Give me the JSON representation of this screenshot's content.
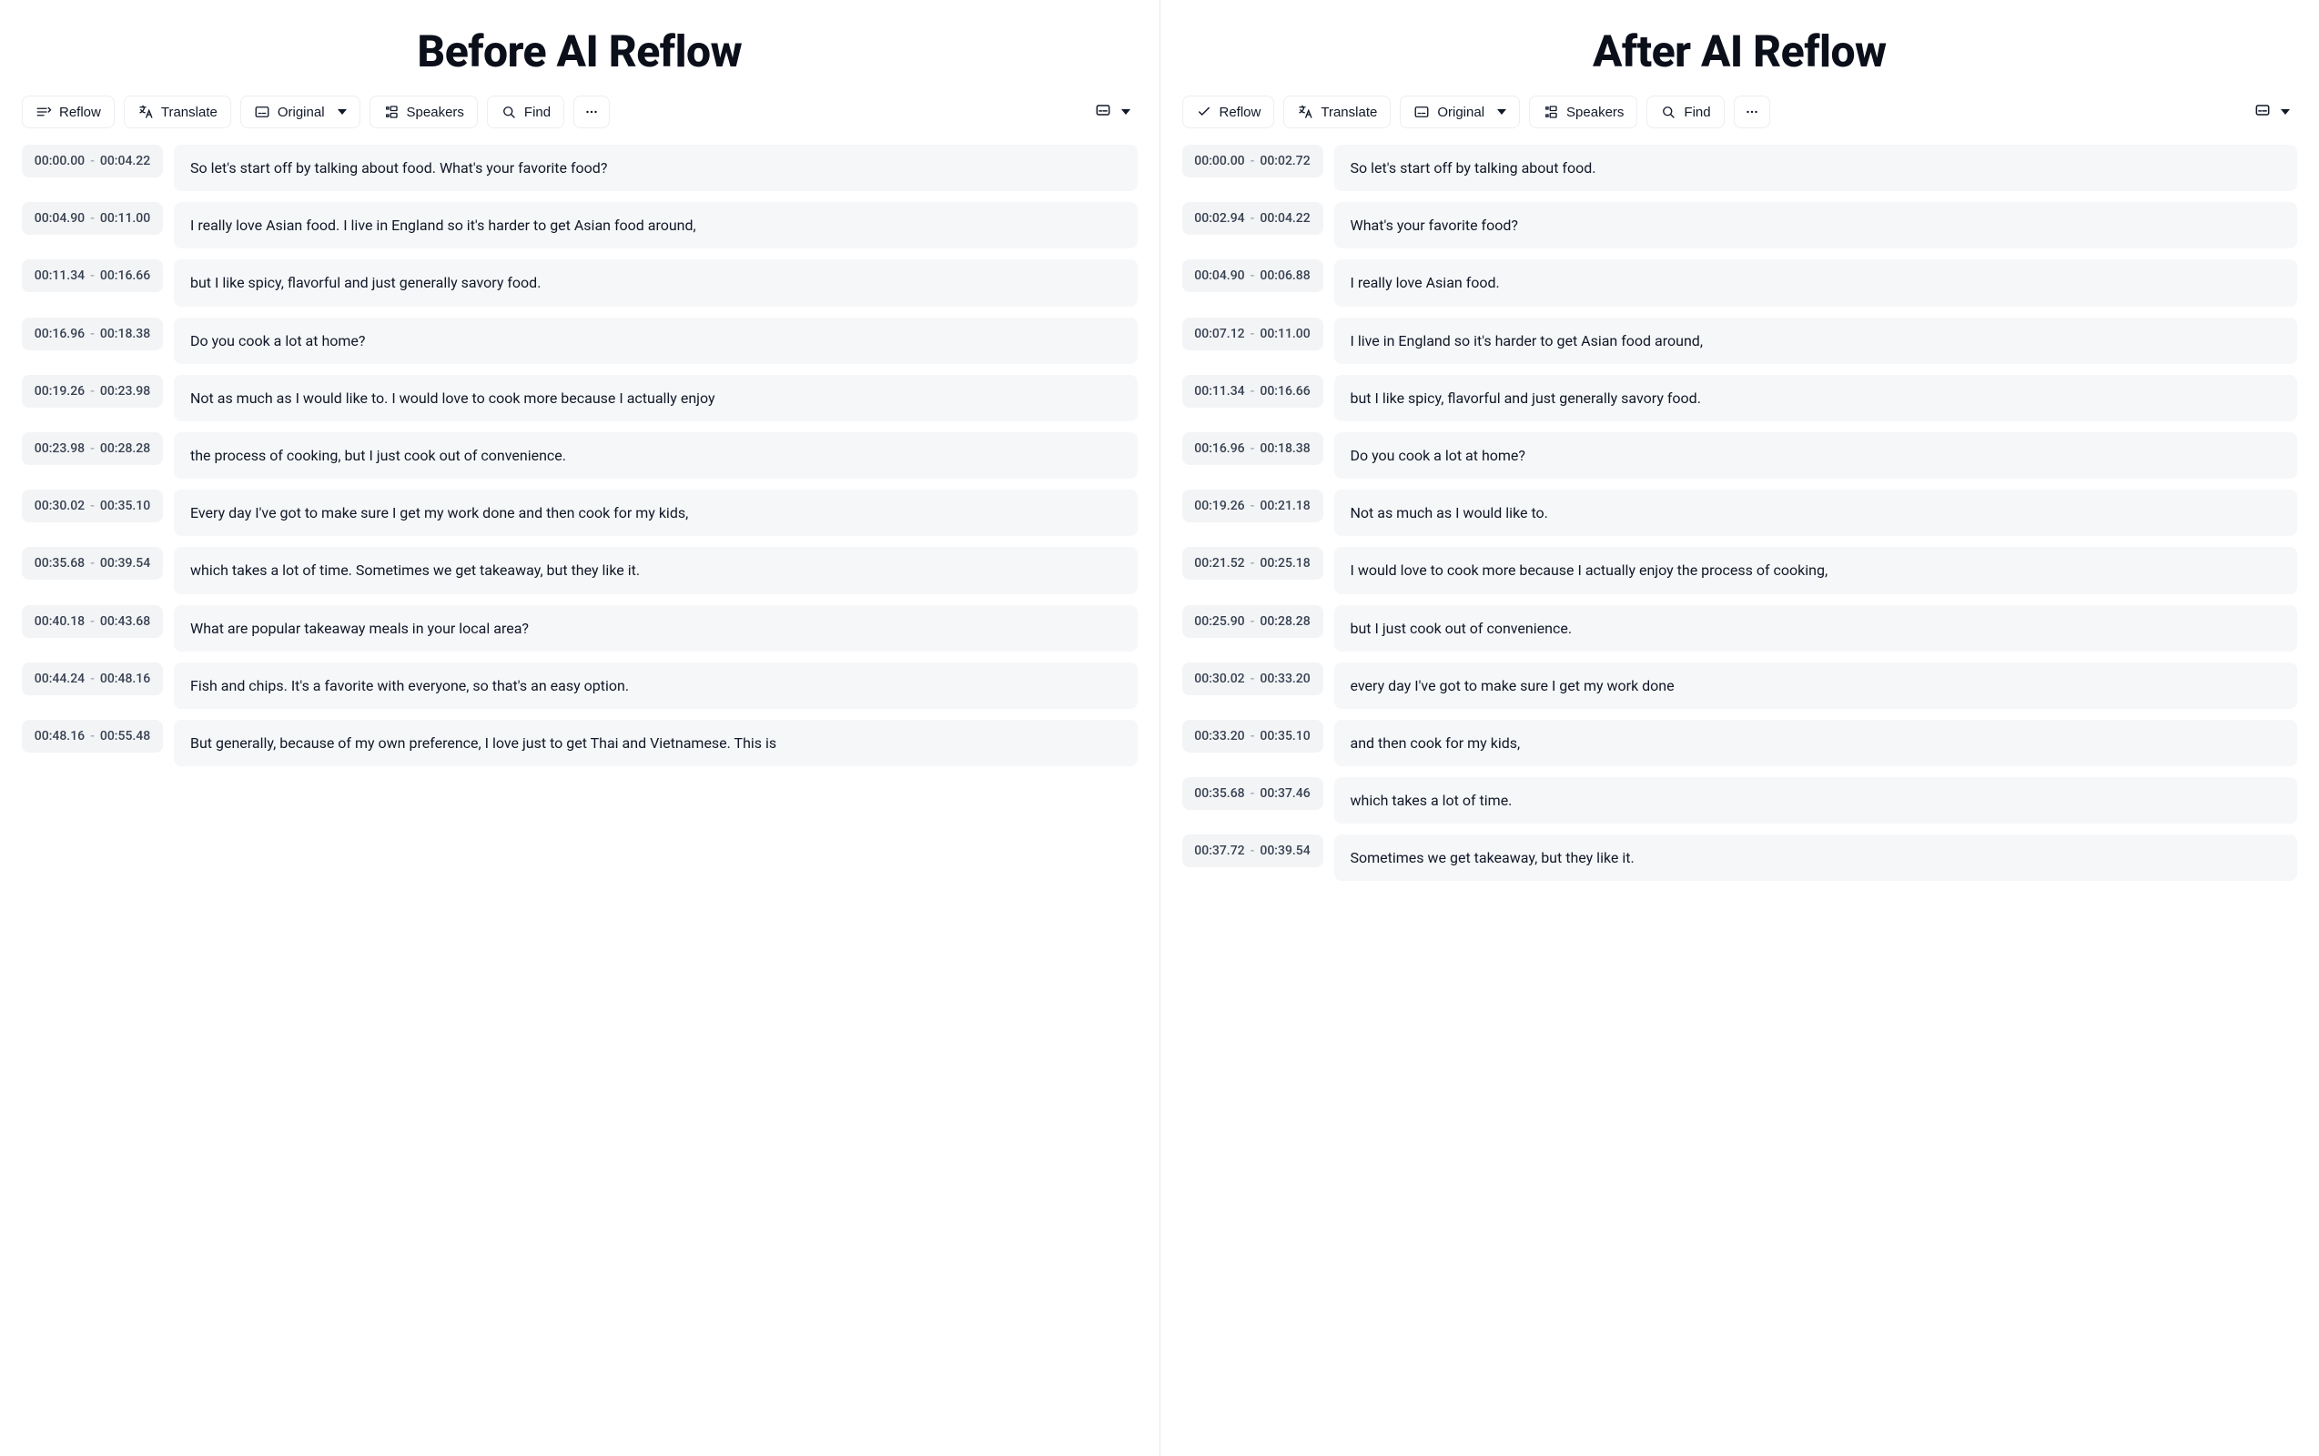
{
  "toolbar": {
    "reflow": "Reflow",
    "translate": "Translate",
    "original": "Original",
    "speakers": "Speakers",
    "find": "Find"
  },
  "icons": {
    "reflow": "reflow-icon",
    "reflow_done": "check-icon",
    "translate": "translate-icon",
    "subtitle": "subtitle-icon",
    "speakers": "speakers-icon",
    "find": "search-icon",
    "more": "more-icon",
    "layout": "layout-icon"
  },
  "before": {
    "title": "Before AI Reflow",
    "segments": [
      {
        "start": "00:00.00",
        "end": "00:04.22",
        "text": "So let's start off by talking about food. What's your favorite food?"
      },
      {
        "start": "00:04.90",
        "end": "00:11.00",
        "text": "I really love Asian food. I live in England so it's harder to get Asian food around,"
      },
      {
        "start": "00:11.34",
        "end": "00:16.66",
        "text": "but I like spicy, flavorful and just generally savory food."
      },
      {
        "start": "00:16.96",
        "end": "00:18.38",
        "text": "Do you cook a lot at home?"
      },
      {
        "start": "00:19.26",
        "end": "00:23.98",
        "text": "Not as much as I would like to. I would love to cook more because I actually enjoy"
      },
      {
        "start": "00:23.98",
        "end": "00:28.28",
        "text": "the process of cooking, but I just cook out of convenience."
      },
      {
        "start": "00:30.02",
        "end": "00:35.10",
        "text": "Every day I've got to make sure I get my work done and then cook for my kids,"
      },
      {
        "start": "00:35.68",
        "end": "00:39.54",
        "text": "which takes a lot of time. Sometimes we get takeaway, but they like it."
      },
      {
        "start": "00:40.18",
        "end": "00:43.68",
        "text": "What are popular takeaway meals in your local area?"
      },
      {
        "start": "00:44.24",
        "end": "00:48.16",
        "text": "Fish and chips. It's a favorite with everyone, so that's an easy option."
      },
      {
        "start": "00:48.16",
        "end": "00:55.48",
        "text": "But generally, because of my own preference, I love just to get Thai and Vietnamese. This is"
      }
    ]
  },
  "after": {
    "title": "After AI Reflow",
    "segments": [
      {
        "start": "00:00.00",
        "end": "00:02.72",
        "text": "So let's start off by talking about food."
      },
      {
        "start": "00:02.94",
        "end": "00:04.22",
        "text": "What's your favorite food?"
      },
      {
        "start": "00:04.90",
        "end": "00:06.88",
        "text": "I really love Asian food."
      },
      {
        "start": "00:07.12",
        "end": "00:11.00",
        "text": "I live in England so it's harder to get Asian food around,"
      },
      {
        "start": "00:11.34",
        "end": "00:16.66",
        "text": "but I like spicy, flavorful and just generally savory food."
      },
      {
        "start": "00:16.96",
        "end": "00:18.38",
        "text": "Do you cook a lot at home?"
      },
      {
        "start": "00:19.26",
        "end": "00:21.18",
        "text": "Not as much as I would like to."
      },
      {
        "start": "00:21.52",
        "end": "00:25.18",
        "text": "I would love to cook more because I actually enjoy the process of cooking,"
      },
      {
        "start": "00:25.90",
        "end": "00:28.28",
        "text": "but I just cook out of convenience."
      },
      {
        "start": "00:30.02",
        "end": "00:33.20",
        "text": "every day I've got to make sure I get my work done"
      },
      {
        "start": "00:33.20",
        "end": "00:35.10",
        "text": "and then cook for my kids,"
      },
      {
        "start": "00:35.68",
        "end": "00:37.46",
        "text": "which takes a lot of time."
      },
      {
        "start": "00:37.72",
        "end": "00:39.54",
        "text": "Sometimes we get takeaway, but they like it."
      }
    ]
  }
}
